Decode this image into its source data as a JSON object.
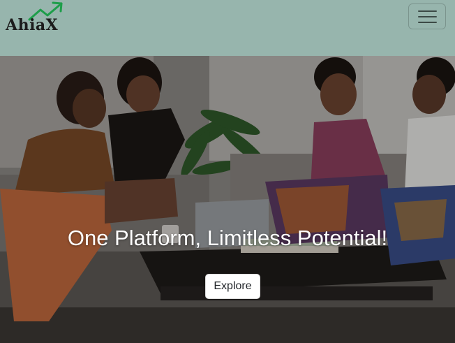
{
  "brand": {
    "name": "AhiaX",
    "arrow_color": "#1e9e4a"
  },
  "navbar": {
    "background": "#97b5ad",
    "toggler_icon": "hamburger-menu-icon"
  },
  "hero": {
    "title": "One Platform, Limitless Potential!",
    "cta_label": "Explore",
    "image_description_icon": "group-of-women-photo"
  }
}
